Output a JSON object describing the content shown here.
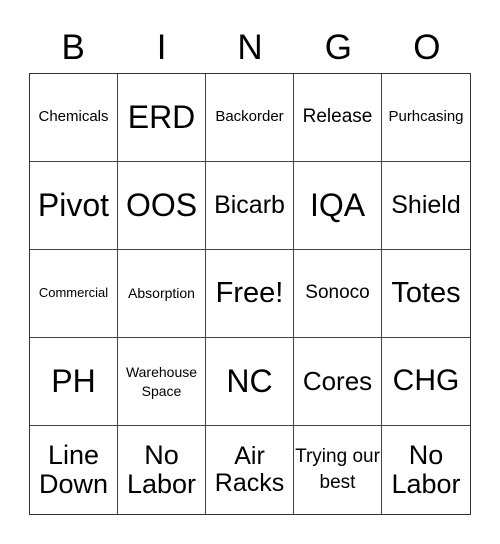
{
  "header": {
    "letters": [
      "B",
      "I",
      "N",
      "G",
      "O"
    ]
  },
  "card": {
    "cells": [
      [
        "Chemicals",
        "ERD",
        "Backorder",
        "Release",
        "Purhcasing"
      ],
      [
        "Pivot",
        "OOS",
        "Bicarb",
        "IQA",
        "Shield"
      ],
      [
        "Commercial",
        "Absorption",
        "Free!",
        "Sonoco",
        "Totes"
      ],
      [
        "PH",
        "Warehouse Space",
        "NC",
        "Cores",
        "CHG"
      ],
      [
        "Line Down",
        "No Labor",
        "Air Racks",
        "Trying our best",
        "No Labor"
      ]
    ]
  }
}
